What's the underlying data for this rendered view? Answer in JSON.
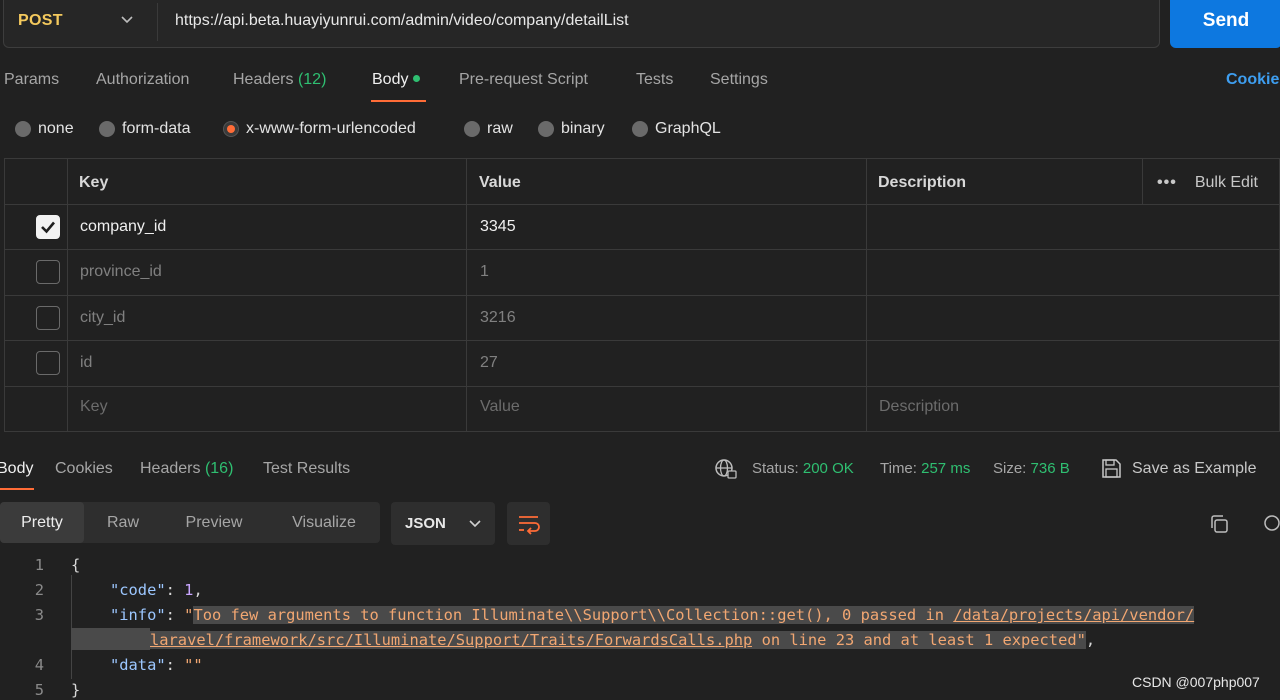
{
  "request": {
    "method": "POST",
    "url": "https://api.beta.huayiyunrui.com/admin/video/company/detailList",
    "send_label": "Send"
  },
  "tabs": {
    "params": "Params",
    "authorization": "Authorization",
    "headers": "Headers",
    "headers_count": "(12)",
    "body": "Body",
    "prerequest": "Pre-request Script",
    "tests": "Tests",
    "settings": "Settings",
    "cookies": "Cookie"
  },
  "body_types": [
    "none",
    "form-data",
    "x-www-form-urlencoded",
    "raw",
    "binary",
    "GraphQL"
  ],
  "body_selected": "x-www-form-urlencoded",
  "table": {
    "headers": {
      "key": "Key",
      "value": "Value",
      "description": "Description",
      "bulk_edit": "Bulk Edit"
    },
    "rows": [
      {
        "checked": true,
        "key": "company_id",
        "value": "3345"
      },
      {
        "checked": false,
        "key": "province_id",
        "value": "1"
      },
      {
        "checked": false,
        "key": "city_id",
        "value": "3216"
      },
      {
        "checked": false,
        "key": "id",
        "value": "27"
      }
    ],
    "placeholder": {
      "key": "Key",
      "value": "Value",
      "description": "Description"
    }
  },
  "response": {
    "tabs": {
      "body": "Body",
      "cookies": "Cookies",
      "headers": "Headers",
      "headers_count": "(16)",
      "test_results": "Test Results"
    },
    "status_label": "Status:",
    "status_value": "200 OK",
    "time_label": "Time:",
    "time_value": "257 ms",
    "size_label": "Size:",
    "size_value": "736 B",
    "save_example": "Save as Example",
    "views": [
      "Pretty",
      "Raw",
      "Preview",
      "Visualize"
    ],
    "active_view": "Pretty",
    "format": "JSON"
  },
  "code": {
    "line_numbers": [
      "1",
      "2",
      "3",
      "4",
      "5"
    ],
    "open_brace": "{",
    "code_key": "\"code\"",
    "code_val": "1",
    "info_key": "\"info\"",
    "info_q1": "\"",
    "info_text1": "Too few arguments to function Illuminate\\\\Support\\\\Collection::get(), 0 passed in ",
    "info_path1": "/data/projects/api/vendor/",
    "info_path2": "laravel/framework/src/Illuminate/Support/Traits/ForwardsCalls.php",
    "info_text2": " on line 23 and at least 1 expected",
    "info_q2": "\"",
    "data_key": "\"data\"",
    "data_val": "\"\"",
    "close_brace": "}"
  },
  "watermark": "CSDN @007php007",
  "colors": {
    "accent": "#ff6c37",
    "send": "#0d78e0",
    "success": "#2fbf71",
    "method": "#f4c95d"
  }
}
